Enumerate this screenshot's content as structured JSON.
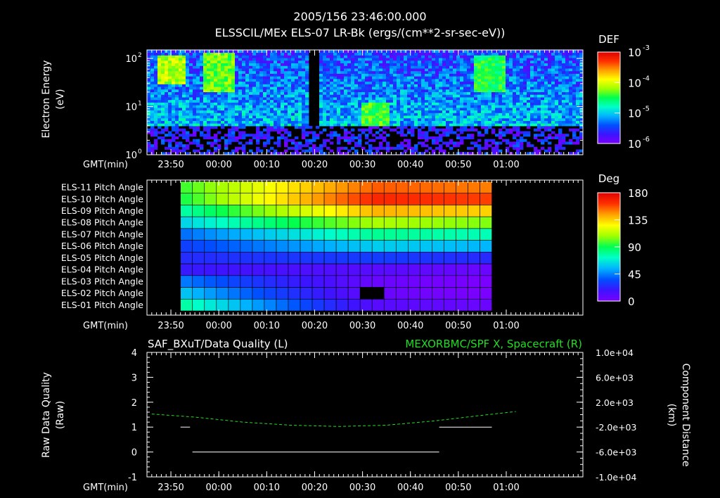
{
  "header": {
    "timestamp": "2005/156 23:46:00.000",
    "title": "ELSSCIL/MEx ELS-07 LR-Bk  (ergs/(cm**2-sr-sec-eV))"
  },
  "time_axis": {
    "label": "GMT(min)",
    "ticks": [
      "23:50",
      "00:00",
      "00:10",
      "00:20",
      "00:30",
      "00:40",
      "00:50",
      "01:00"
    ]
  },
  "colors": {
    "background": "#000000",
    "foreground": "#ffffff",
    "right_axis": "#22dd22",
    "colormap": [
      "#7a00ff",
      "#3c14ff",
      "#0050ff",
      "#00b4ff",
      "#00ffc8",
      "#00ff50",
      "#a0ff00",
      "#ffff00",
      "#ffa000",
      "#ff3000",
      "#e00000"
    ]
  },
  "chart_data": [
    {
      "type": "heatmap",
      "ylabel": "Electron Energy (eV)",
      "ylabel_lines": [
        "Electron Energy",
        "(eV)"
      ],
      "y_scale": "log",
      "ylim": [
        1,
        150
      ],
      "y_ticks": [
        {
          "base": "10",
          "exp": "0"
        },
        {
          "base": "10",
          "exp": "1"
        },
        {
          "base": "10",
          "exp": "2"
        }
      ],
      "x_ticks": [
        "23:50",
        "00:00",
        "00:10",
        "00:20",
        "00:30",
        "00:40",
        "00:50",
        "01:00"
      ],
      "xlabel": "GMT(min)",
      "colorbar": {
        "title": "DEF",
        "scale": "log",
        "ticks": [
          {
            "base": "10",
            "exp": "-3"
          },
          {
            "base": "10",
            "exp": "-4"
          },
          {
            "base": "10",
            "exp": "-5"
          },
          {
            "base": "10",
            "exp": "-6"
          }
        ]
      },
      "features": [
        {
          "desc": "noise floor",
          "energy_below_eV": 4,
          "level_log10": -5.9
        },
        {
          "time_start": "23:47",
          "time_end": "23:53",
          "energy_range_eV": [
            30,
            110
          ],
          "level_log10": -4.2
        },
        {
          "time_start": "23:57",
          "time_end": "00:03",
          "energy_range_eV": [
            20,
            140
          ],
          "level_log10": -4.4
        },
        {
          "time_start": "00:19",
          "time_end": "00:21",
          "level_log10": -6.5,
          "desc": "data gap"
        },
        {
          "time_start": "00:30",
          "time_end": "00:36",
          "energy_range_eV": [
            3.5,
            12
          ],
          "level_log10": -4.5
        },
        {
          "time_start": "00:53",
          "time_end": "01:00",
          "energy_range_eV": [
            20,
            120
          ],
          "level_log10": -4.6
        }
      ]
    },
    {
      "type": "heatmap",
      "rows": [
        "ELS-11 Pitch Angle",
        "ELS-10 Pitch Angle",
        "ELS-09 Pitch Angle",
        "ELS-08 Pitch Angle",
        "ELS-07 Pitch Angle",
        "ELS-06 Pitch Angle",
        "ELS-05 Pitch Angle",
        "ELS-04 Pitch Angle",
        "ELS-03 Pitch Angle",
        "ELS-02 Pitch Angle",
        "ELS-01 Pitch Angle"
      ],
      "x_ticks": [
        "23:50",
        "00:00",
        "00:10",
        "00:20",
        "00:30",
        "00:40",
        "00:50",
        "01:00"
      ],
      "xlabel": "GMT(min)",
      "data_time_range": [
        "23:52",
        "00:57"
      ],
      "pitch_angle_deg_at_start": [
        95,
        90,
        75,
        60,
        40,
        30,
        25,
        20,
        45,
        60,
        80
      ],
      "pitch_angle_deg_at_peak": [
        155,
        165,
        140,
        110,
        80,
        60,
        30,
        10,
        5,
        5,
        10
      ],
      "peak_time": "00:33",
      "gap": {
        "row": "ELS-02 Pitch Angle",
        "time_start": "00:30",
        "time_end": "00:35"
      },
      "colorbar": {
        "title": "Deg",
        "range": [
          0,
          180
        ],
        "ticks": [
          "180",
          "135",
          "90",
          "45",
          "0"
        ]
      }
    },
    {
      "type": "line",
      "title_left": "SAF_BXuT/Data Quality (L)",
      "title_right": "MEXORBMC/SPF X, Spacecraft (R)",
      "ylabel_left": "Raw Data Quality (Raw)",
      "ylabel_left_lines": [
        "Raw Data Quality",
        "(Raw)"
      ],
      "ylim_left": [
        -1,
        4
      ],
      "left_ticks": [
        "4",
        "3",
        "2",
        "1",
        "0",
        "-1"
      ],
      "ylabel_right": "Component Distance (km)",
      "ylabel_right_lines": [
        "Component Distance",
        "(km)"
      ],
      "ylim_right": [
        -10000,
        10000
      ],
      "right_ticks": [
        "1.0e+04",
        "6.0e+03",
        "2.0e+03",
        "-2.0e+03",
        "-6.0e+03",
        "-1.0e+04"
      ],
      "x_ticks": [
        "23:50",
        "00:00",
        "00:10",
        "00:20",
        "00:30",
        "00:40",
        "00:50",
        "01:00"
      ],
      "xlabel": "GMT(min)",
      "series": [
        {
          "name": "SAF_BXuT/Data Quality",
          "axis": "left",
          "style": "solid",
          "color": "#ffffff",
          "segments": [
            {
              "x": [
                "23:52",
                "23:54"
              ],
              "y": [
                1,
                1
              ]
            },
            {
              "x": [
                "23:54.5",
                "00:46"
              ],
              "y": [
                0,
                0
              ]
            },
            {
              "x": [
                "00:46",
                "00:57"
              ],
              "y": [
                1,
                1
              ]
            }
          ]
        },
        {
          "name": "MEXORBMC/SPF X, Spacecraft",
          "axis": "right",
          "style": "dashed",
          "color": "#22dd22",
          "x": [
            "23:46",
            "23:55",
            "00:05",
            "00:15",
            "00:25",
            "00:35",
            "00:45",
            "00:55",
            "01:02"
          ],
          "y": [
            100,
            -400,
            -1200,
            -1700,
            -1900,
            -1700,
            -1000,
            -100,
            500
          ]
        }
      ]
    }
  ]
}
